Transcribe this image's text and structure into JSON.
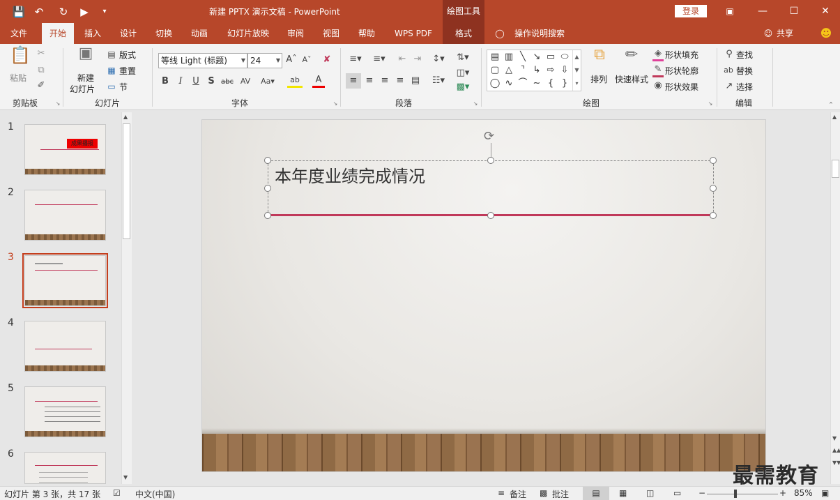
{
  "titlebar": {
    "title": "新建 PPTX 演示文稿  -  PowerPoint",
    "context_tools": "绘图工具",
    "login": "登录"
  },
  "tabs": [
    "文件",
    "开始",
    "插入",
    "设计",
    "切换",
    "动画",
    "幻灯片放映",
    "审阅",
    "视图",
    "帮助",
    "WPS PDF",
    "格式"
  ],
  "active_tab": "开始",
  "search_label": "操作说明搜索",
  "share_label": "共享",
  "ribbon": {
    "clipboard": {
      "paste": "粘贴",
      "group": "剪贴板"
    },
    "slides": {
      "new_slide_1": "新建",
      "new_slide_2": "幻灯片",
      "layout": "版式",
      "reset": "重置",
      "section": "节",
      "group": "幻灯片"
    },
    "font": {
      "font_name": "等线 Light (标题)",
      "font_size": "24",
      "group": "字体"
    },
    "paragraph": {
      "group": "段落"
    },
    "drawing": {
      "arrange": "排列",
      "quick_styles": "快速样式",
      "shape_fill": "形状填充",
      "shape_outline": "形状轮廓",
      "shape_effects": "形状效果",
      "group": "绘图"
    },
    "editing": {
      "find": "查找",
      "replace": "替换",
      "select": "选择",
      "group": "编辑"
    }
  },
  "thumbnails": [
    {
      "num": "1",
      "label": "成果播报"
    },
    {
      "num": "2"
    },
    {
      "num": "3"
    },
    {
      "num": "4"
    },
    {
      "num": "5"
    },
    {
      "num": "6"
    }
  ],
  "selected_slide": "3",
  "slide": {
    "title": "本年度业绩完成情况"
  },
  "status": {
    "slide_info": "幻灯片 第 3 张，共 17 张",
    "language": "中文(中国)",
    "notes": "备注",
    "comments": "批注",
    "zoom": "85%"
  },
  "watermark": "最需教育",
  "colors": {
    "accent": "#b7472a",
    "title_line": "#c0395a",
    "selected": "#c43e1c"
  }
}
